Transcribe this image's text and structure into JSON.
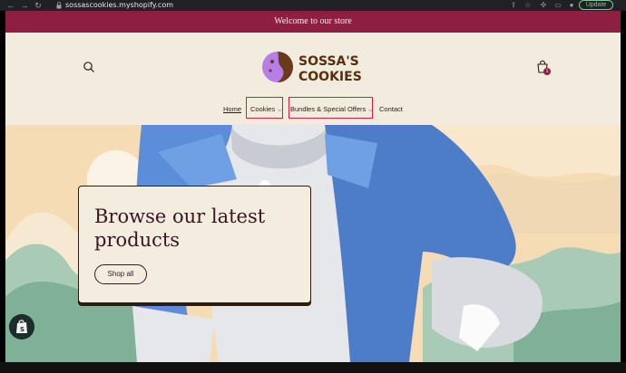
{
  "browser": {
    "url": "sossascookies.myshopify.com",
    "update_label": "Update"
  },
  "store": {
    "announcement": "Welcome to our store",
    "logo_line1": "SOSSA'S",
    "logo_line2": "COOKIES",
    "cart_count": "1",
    "nav": [
      {
        "label": "Home"
      },
      {
        "label": "Cookies"
      },
      {
        "label": "Bundles & Special Offers"
      },
      {
        "label": "Contact"
      }
    ]
  },
  "hero": {
    "title": "Browse our latest products",
    "button_label": "Shop all"
  },
  "colors": {
    "announcement_bg": "#8f1e43",
    "page_bg": "#f2ecde",
    "text_dark": "#3a1420",
    "highlight": "#e0193c"
  }
}
